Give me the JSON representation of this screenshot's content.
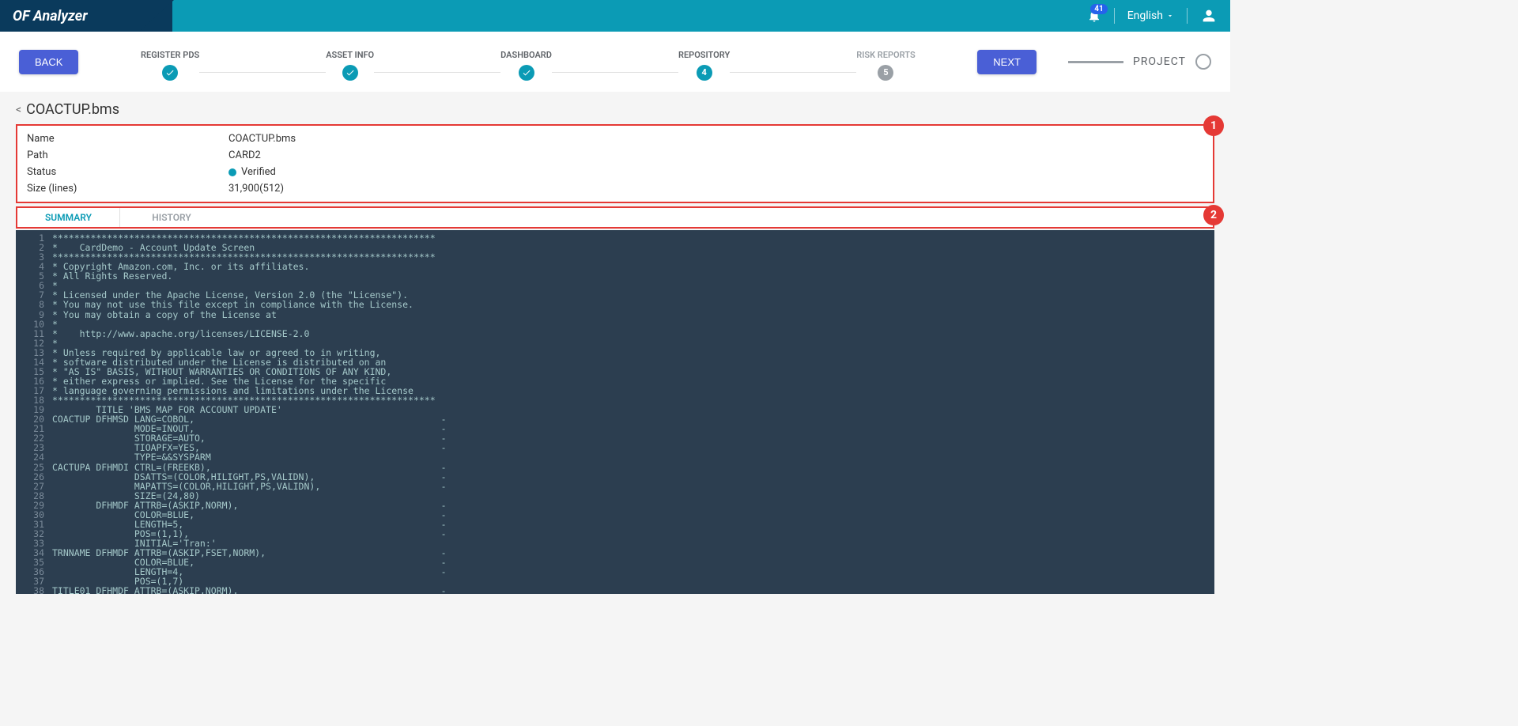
{
  "header": {
    "logo": "OF Analyzer",
    "notification_count": "41",
    "language": "English"
  },
  "steps": {
    "back": "BACK",
    "next": "NEXT",
    "items": [
      {
        "label": "REGISTER PDS",
        "state": "done"
      },
      {
        "label": "ASSET INFO",
        "state": "done"
      },
      {
        "label": "DASHBOARD",
        "state": "done"
      },
      {
        "label": "REPOSITORY",
        "state": "current",
        "num": "4"
      },
      {
        "label": "RISK REPORTS",
        "state": "pending",
        "num": "5"
      }
    ],
    "project": "PROJECT"
  },
  "breadcrumb": {
    "title": "COACTUP.bms"
  },
  "details": {
    "rows": [
      {
        "label": "Name",
        "value": "COACTUP.bms"
      },
      {
        "label": "Path",
        "value": "CARD2"
      },
      {
        "label": "Status",
        "value": "Verified",
        "dot": true
      },
      {
        "label": "Size (lines)",
        "value": "31,900(512)"
      }
    ]
  },
  "annotations": {
    "a1": "1",
    "a2": "2"
  },
  "tabs": [
    {
      "label": "SUMMARY",
      "active": true
    },
    {
      "label": "HISTORY",
      "active": false
    }
  ],
  "code": [
    "**********************************************************************",
    "*    CardDemo - Account Update Screen",
    "**********************************************************************",
    "* Copyright Amazon.com, Inc. or its affiliates.",
    "* All Rights Reserved.",
    "*",
    "* Licensed under the Apache License, Version 2.0 (the \"License\").",
    "* You may not use this file except in compliance with the License.",
    "* You may obtain a copy of the License at",
    "*",
    "*    http://www.apache.org/licenses/LICENSE-2.0",
    "*",
    "* Unless required by applicable law or agreed to in writing,",
    "* software distributed under the License is distributed on an",
    "* \"AS IS\" BASIS, WITHOUT WARRANTIES OR CONDITIONS OF ANY KIND,",
    "* either express or implied. See the License for the specific",
    "* language governing permissions and limitations under the License",
    "**********************************************************************",
    "        TITLE 'BMS MAP FOR ACCOUNT UPDATE'",
    "COACTUP DFHMSD LANG=COBOL,                                             -",
    "               MODE=INOUT,                                             -",
    "               STORAGE=AUTO,                                           -",
    "               TIOAPFX=YES,                                            -",
    "               TYPE=&&SYSPARM",
    "CACTUPA DFHMDI CTRL=(FREEKB),                                          -",
    "               DSATTS=(COLOR,HILIGHT,PS,VALIDN),                       -",
    "               MAPATTS=(COLOR,HILIGHT,PS,VALIDN),                      -",
    "               SIZE=(24,80)",
    "        DFHMDF ATTRB=(ASKIP,NORM),                                     -",
    "               COLOR=BLUE,                                             -",
    "               LENGTH=5,                                               -",
    "               POS=(1,1),                                              -",
    "               INITIAL='Tran:'",
    "TRNNAME DFHMDF ATTRB=(ASKIP,FSET,NORM),                                -",
    "               COLOR=BLUE,                                             -",
    "               LENGTH=4,                                               -",
    "               POS=(1,7)",
    "TITLE01 DFHMDF ATTRB=(ASKIP,NORM),                                     -"
  ]
}
